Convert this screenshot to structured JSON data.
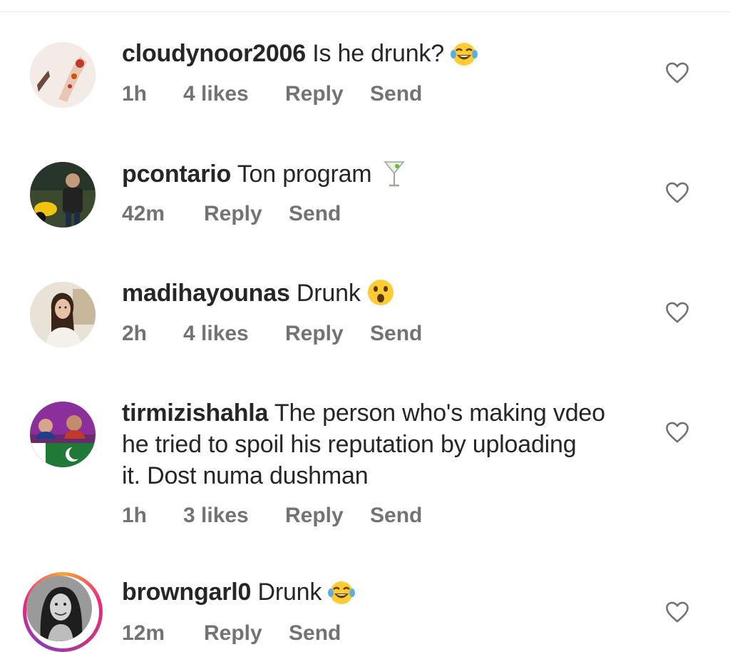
{
  "comments": [
    {
      "username": "cloudynoor2006",
      "text": "Is he drunk?",
      "emoji": "laughing-tears-emoji",
      "time": "1h",
      "likes": "4 likes",
      "reply": "Reply",
      "send": "Send"
    },
    {
      "username": "pcontario",
      "text": "Ton program",
      "emoji": "cocktail-glass-emoji",
      "time": "42m",
      "likes": "",
      "reply": "Reply",
      "send": "Send"
    },
    {
      "username": "madihayounas",
      "text": "Drunk",
      "emoji": "astonished-face-emoji",
      "time": "2h",
      "likes": "4 likes",
      "reply": "Reply",
      "send": "Send"
    },
    {
      "username": "tirmizishahla",
      "text": "The person who's making vdeo",
      "text_line2": "he tried to spoil his reputation by uploading",
      "text_line3": "it. Dost numa dushman",
      "time": "1h",
      "likes": "3 likes",
      "reply": "Reply",
      "send": "Send"
    },
    {
      "username": "browngarl0",
      "text": "Drunk",
      "emoji": "laughing-tears-emoji",
      "time": "12m",
      "likes": "",
      "reply": "Reply",
      "send": "Send",
      "story_ring": true
    }
  ],
  "colors": {
    "primary_text": "#262626",
    "secondary_text": "#737373",
    "divider": "#e6e6e6"
  },
  "icons": {
    "like": "heart-outline-icon"
  }
}
